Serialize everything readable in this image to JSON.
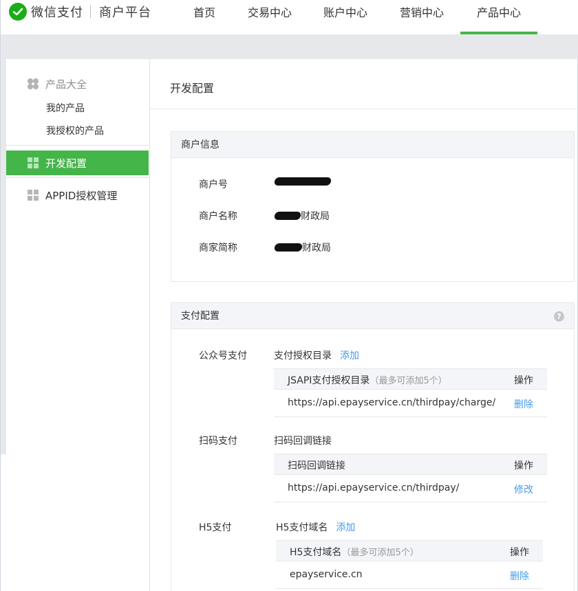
{
  "header": {
    "brand": "微信支付",
    "brand_sub": "商户平台",
    "nav": [
      "首页",
      "交易中心",
      "账户中心",
      "营销中心",
      "产品中心"
    ],
    "active_nav": "产品中心",
    "accent_color": "#44b549"
  },
  "sidebar": {
    "group_title": "产品大全",
    "group_items": [
      "我的产品",
      "我授权的产品"
    ],
    "dev_config": "开发配置",
    "appid_auth": "APPID授权管理"
  },
  "main": {
    "page_title": "开发配置",
    "merchant_info": {
      "title": "商户信息",
      "rows": [
        {
          "label": "商户号",
          "value": ""
        },
        {
          "label": "商户名称",
          "value": "财政局"
        },
        {
          "label": "商家简称",
          "value": "财政局"
        }
      ]
    },
    "pay_config": {
      "title": "支付配置",
      "help": "?",
      "jsapi": {
        "label": "公众号支付",
        "title": "支付授权目录",
        "add": "添加",
        "col1": "JSAPI支付授权目录",
        "col1_hint": "（最多可添加5个）",
        "col2": "操作",
        "url": "https://api.epayservice.cn/thirdpay/charge/",
        "action": "删除"
      },
      "native": {
        "label": "扫码支付",
        "title": "扫码回调链接",
        "col1": "扫码回调链接",
        "col2": "操作",
        "url": "https://api.epayservice.cn/thirdpay/",
        "action": "修改"
      },
      "h5": {
        "label": "H5支付",
        "title": "H5支付域名",
        "add": "添加",
        "col1": "H5支付域名",
        "col1_hint": "（最多可添加5个）",
        "col2": "操作",
        "domain": "epayservice.cn",
        "action": "删除"
      }
    }
  }
}
